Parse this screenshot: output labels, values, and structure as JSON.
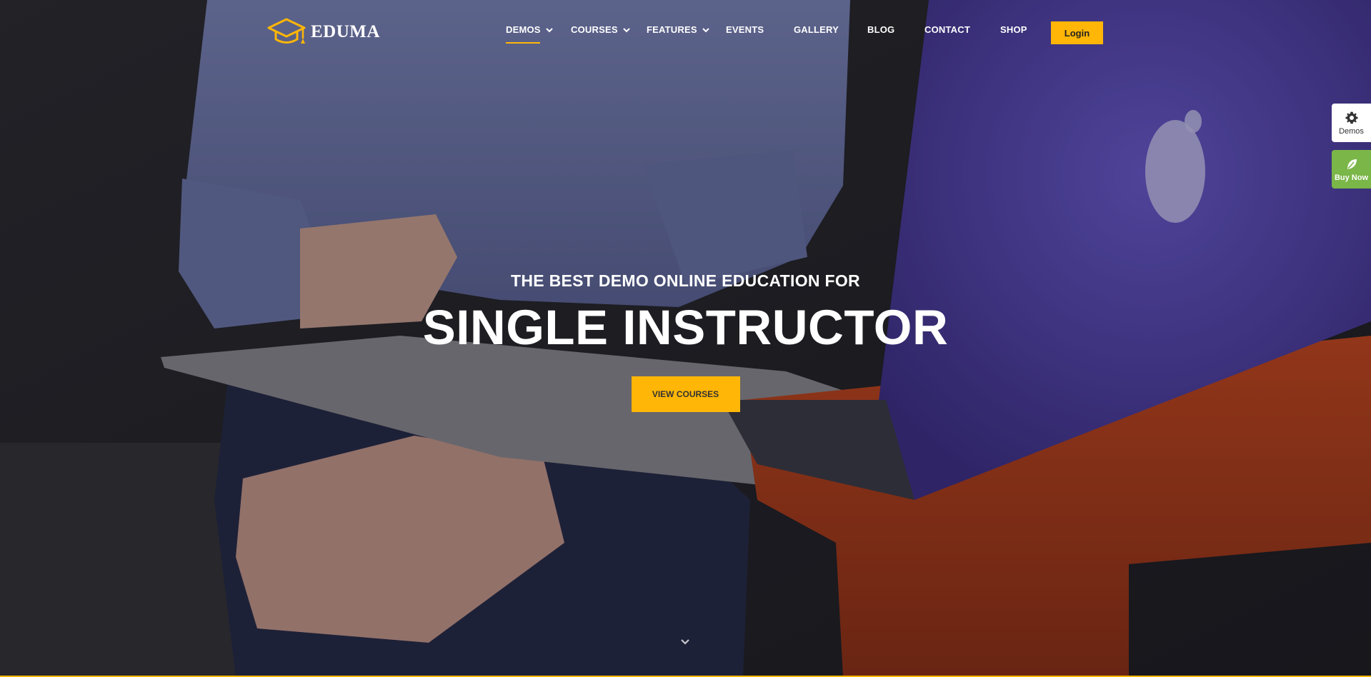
{
  "brand": {
    "name": "EDUMA",
    "accent_color": "#ffb606",
    "logo_icon": "graduation-cap-icon"
  },
  "nav": {
    "items": [
      {
        "label": "DEMOS",
        "has_dropdown": true,
        "active": true
      },
      {
        "label": "COURSES",
        "has_dropdown": true,
        "active": false
      },
      {
        "label": "FEATURES",
        "has_dropdown": true,
        "active": false
      },
      {
        "label": "EVENTS",
        "has_dropdown": false,
        "active": false
      },
      {
        "label": "GALLERY",
        "has_dropdown": false,
        "active": false
      },
      {
        "label": "BLOG",
        "has_dropdown": false,
        "active": false
      },
      {
        "label": "CONTACT",
        "has_dropdown": false,
        "active": false
      },
      {
        "label": "SHOP",
        "has_dropdown": false,
        "active": false
      }
    ],
    "login_label": "Login"
  },
  "side_widgets": {
    "demos": {
      "label": "Demos",
      "icon": "gear-icon"
    },
    "buy_now": {
      "label": "Buy Now",
      "icon": "leaf-icon",
      "color": "#7ab648"
    }
  },
  "hero": {
    "subtitle": "THE BEST DEMO ONLINE EDUCATION FOR",
    "title": "SINGLE INSTRUCTOR",
    "cta_label": "VIEW COURSES",
    "scroll_icon": "chevron-down-icon"
  }
}
